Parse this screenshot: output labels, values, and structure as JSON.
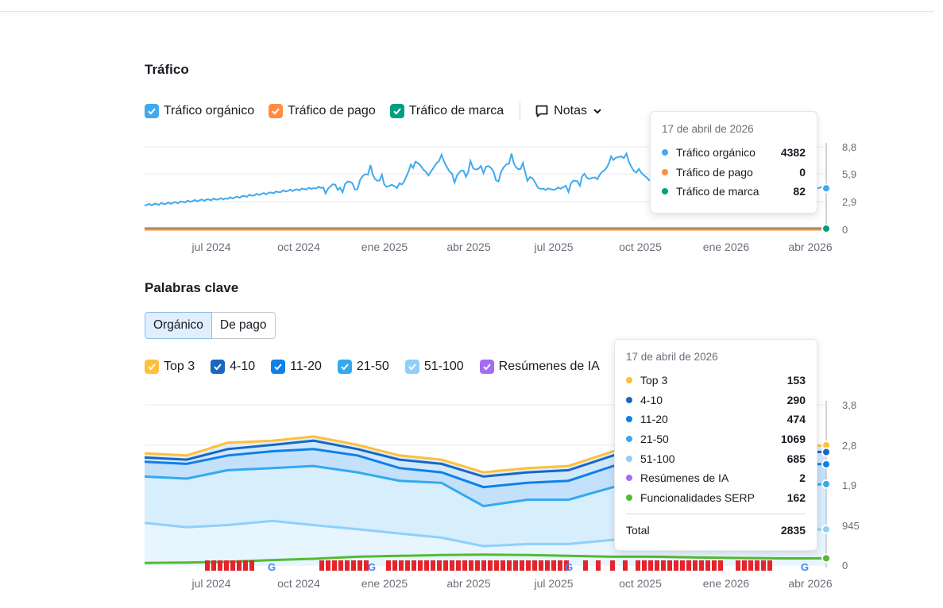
{
  "traffic": {
    "title": "Tráfico",
    "legend": [
      {
        "label": "Tráfico orgánico",
        "color": "#41a9ef"
      },
      {
        "label": "Tráfico de pago",
        "color": "#ff8c43"
      },
      {
        "label": "Tráfico de marca",
        "color": "#009f81"
      }
    ],
    "notes_label": "Notas",
    "tooltip": {
      "date": "17 de abril de 2026",
      "rows": [
        {
          "name": "Tráfico orgánico",
          "value": "4382",
          "color": "#41a9ef"
        },
        {
          "name": "Tráfico de pago",
          "value": "0",
          "color": "#ff8c43"
        },
        {
          "name": "Tráfico de marca",
          "value": "82",
          "color": "#009f81"
        }
      ]
    }
  },
  "keywords": {
    "title": "Palabras clave",
    "tabs": [
      "Orgánico",
      "De pago"
    ],
    "legend": [
      {
        "label": "Top 3",
        "color": "#fec03a"
      },
      {
        "label": "4-10",
        "color": "#1a66c2"
      },
      {
        "label": "11-20",
        "color": "#0e80ea"
      },
      {
        "label": "21-50",
        "color": "#34a9f0"
      },
      {
        "label": "51-100",
        "color": "#8fd0fb"
      },
      {
        "label": "Resúmenes de IA",
        "color": "#a36cf5"
      }
    ],
    "tooltip": {
      "date": "17 de abril de 2026",
      "rows": [
        {
          "name": "Top 3",
          "value": "153",
          "color": "#fec03a"
        },
        {
          "name": "4-10",
          "value": "290",
          "color": "#1a66c2"
        },
        {
          "name": "11-20",
          "value": "474",
          "color": "#0e80ea"
        },
        {
          "name": "21-50",
          "value": "1069",
          "color": "#34a9f0"
        },
        {
          "name": "51-100",
          "value": "685",
          "color": "#8fd0fb"
        },
        {
          "name": "Resúmenes de IA",
          "value": "2",
          "color": "#a36cf5"
        },
        {
          "name": "Funcionalidades SERP",
          "value": "162",
          "color": "#53bb32"
        }
      ],
      "total_label": "Total",
      "total_value": "2835"
    }
  },
  "chart_data": [
    {
      "type": "line",
      "title": "Tráfico",
      "x_ticks": [
        "jul 2024",
        "oct 2024",
        "ene 2025",
        "abr 2025",
        "jul 2025",
        "oct 2025",
        "ene 2026",
        "abr 2026"
      ],
      "y_ticks": [
        "0",
        "2,9",
        "5,9",
        "8,8"
      ],
      "ylim": [
        0,
        8.8
      ],
      "x_range": [
        "2024-04-17",
        "2026-04-17"
      ],
      "series": [
        {
          "name": "Tráfico orgánico",
          "color": "#41a9ef",
          "x": [
            "2024-04-17",
            "2024-05-15",
            "2024-06-15",
            "2024-07-15",
            "2024-08-15",
            "2024-09-15",
            "2024-10-15",
            "2024-11-15",
            "2024-12-01",
            "2024-12-15",
            "2025-01-01",
            "2025-01-15",
            "2025-02-01",
            "2025-02-15",
            "2025-03-01",
            "2025-03-15",
            "2025-04-01",
            "2025-04-15",
            "2025-05-01",
            "2025-05-15",
            "2025-06-01",
            "2025-06-15",
            "2025-07-01",
            "2025-07-15",
            "2025-08-01",
            "2025-08-15",
            "2025-09-01",
            "2025-09-15",
            "2025-10-01",
            "2025-10-15",
            "2025-11-01",
            "2025-11-15",
            "2025-12-01",
            "2025-12-15",
            "2026-01-01",
            "2026-01-15",
            "2026-02-01",
            "2026-02-15",
            "2026-03-01",
            "2026-03-15",
            "2026-04-01",
            "2026-04-17"
          ],
          "y": [
            2.6,
            2.8,
            3.1,
            3.3,
            3.7,
            4.1,
            4.4,
            4.7,
            5.2,
            6.0,
            4.5,
            4.6,
            7.0,
            6.2,
            7.3,
            5.8,
            6.4,
            6.8,
            6.0,
            7.2,
            5.8,
            4.3,
            4.3,
            4.6,
            5.8,
            5.2,
            8.0,
            7.3,
            5.6,
            5.3,
            5.2,
            5.4,
            5.5,
            5.1,
            5.2,
            5.0,
            4.9,
            4.8,
            4.7,
            4.6,
            4.5,
            4.38
          ]
        },
        {
          "name": "Tráfico de pago",
          "color": "#ff8c43",
          "x": [
            "2024-04-17",
            "2026-04-17"
          ],
          "y": [
            0,
            0
          ]
        },
        {
          "name": "Tráfico de marca",
          "color": "#009f81",
          "x": [
            "2024-04-17",
            "2026-04-17"
          ],
          "y": [
            0.08,
            0.08
          ]
        }
      ]
    },
    {
      "type": "area",
      "title": "Palabras clave",
      "x_ticks": [
        "jul 2024",
        "oct 2024",
        "ene 2025",
        "abr 2025",
        "jul 2025",
        "oct 2025",
        "ene 2026",
        "abr 2026"
      ],
      "y_ticks": [
        "0",
        "945",
        "1,9",
        "2,8",
        "3,8"
      ],
      "ylim": [
        0,
        3.8
      ],
      "x_range": [
        "2024-04-17",
        "2026-04-17"
      ],
      "x": [
        "2024-04-17",
        "2024-06-01",
        "2024-07-15",
        "2024-09-01",
        "2024-10-15",
        "2024-12-01",
        "2025-01-15",
        "2025-03-01",
        "2025-04-15",
        "2025-06-01",
        "2025-07-15",
        "2025-09-01",
        "2025-10-15",
        "2025-12-01",
        "2026-01-15",
        "2026-03-01",
        "2026-04-17"
      ],
      "series": [
        {
          "name": "Top 3",
          "color": "#fec03a",
          "y": [
            2.65,
            2.6,
            2.9,
            2.95,
            3.05,
            2.85,
            2.6,
            2.5,
            2.2,
            2.3,
            2.35,
            2.7,
            2.9,
            2.85,
            2.8,
            2.8,
            2.84
          ]
        },
        {
          "name": "4-10",
          "color": "#1a66c2",
          "y": [
            2.55,
            2.5,
            2.75,
            2.85,
            2.95,
            2.75,
            2.5,
            2.4,
            2.1,
            2.2,
            2.25,
            2.6,
            2.8,
            2.75,
            2.7,
            2.7,
            2.68
          ]
        },
        {
          "name": "11-20",
          "color": "#0e80ea",
          "y": [
            2.45,
            2.4,
            2.6,
            2.7,
            2.75,
            2.6,
            2.3,
            2.2,
            1.85,
            1.95,
            2.0,
            2.35,
            2.55,
            2.5,
            2.45,
            2.42,
            2.39
          ]
        },
        {
          "name": "21-50",
          "color": "#34a9f0",
          "y": [
            2.1,
            2.05,
            2.25,
            2.3,
            2.35,
            2.2,
            2.0,
            1.95,
            1.4,
            1.55,
            1.55,
            1.85,
            2.0,
            1.95,
            1.9,
            1.88,
            1.92
          ]
        },
        {
          "name": "51-100",
          "color": "#8fd0fb",
          "y": [
            1.0,
            0.9,
            0.95,
            1.05,
            0.95,
            0.85,
            0.75,
            0.65,
            0.45,
            0.5,
            0.5,
            0.6,
            0.75,
            0.8,
            0.78,
            0.8,
            0.85
          ]
        },
        {
          "name": "Resúmenes de IA",
          "color": "#a36cf5",
          "y": [
            0,
            0,
            0,
            0,
            0,
            0,
            0,
            0,
            0,
            0,
            0,
            0,
            0,
            0,
            0,
            0,
            0.002
          ]
        },
        {
          "name": "Funcionalidades SERP",
          "color": "#53bb32",
          "y": [
            0.05,
            0.06,
            0.08,
            0.12,
            0.15,
            0.2,
            0.22,
            0.24,
            0.25,
            0.24,
            0.22,
            0.2,
            0.2,
            0.18,
            0.17,
            0.16,
            0.162
          ]
        }
      ]
    }
  ]
}
